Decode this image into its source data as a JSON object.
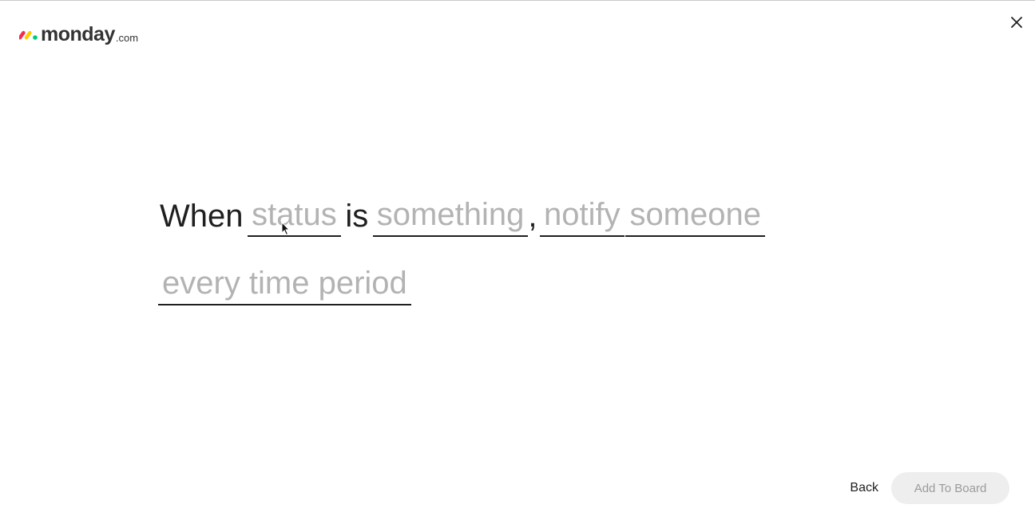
{
  "logo": {
    "word": "monday",
    "suffix": ".com",
    "mark_colors": [
      "#f62b54",
      "#ffcc00",
      "#00ca72"
    ]
  },
  "close": {
    "icon": "close-icon"
  },
  "recipe": {
    "when_label": "When",
    "trigger_field": "status",
    "is_label": "is",
    "trigger_value": "something",
    "comma": ",",
    "action": "notify",
    "target": "someone",
    "frequency": "every time period"
  },
  "footer": {
    "back_label": "Back",
    "add_label": "Add To Board"
  }
}
